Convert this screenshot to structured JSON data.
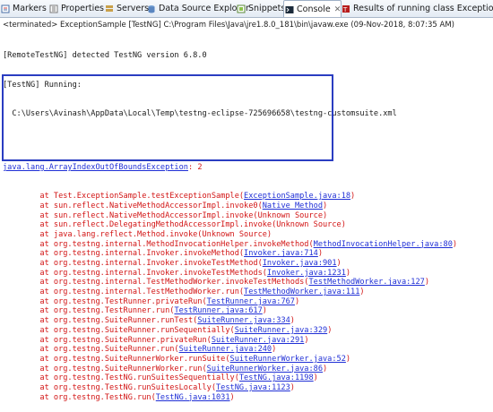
{
  "tabs": [
    {
      "label": "Markers",
      "icon": "markers-icon",
      "active": false
    },
    {
      "label": "Properties",
      "icon": "properties-icon",
      "active": false
    },
    {
      "label": "Servers",
      "icon": "servers-icon",
      "active": false
    },
    {
      "label": "Data Source Explorer",
      "icon": "database-icon",
      "active": false
    },
    {
      "label": "Snippets",
      "icon": "snippets-icon",
      "active": false
    },
    {
      "label": "Console",
      "icon": "console-icon",
      "active": true,
      "close": "✕"
    },
    {
      "label": "Results of running class ExceptionSample",
      "icon": "testng-icon",
      "active": false
    }
  ],
  "status_line": "<terminated> ExceptionSample [TestNG] C:\\Program Files\\Java\\jre1.8.0_181\\bin\\javaw.exe (09-Nov-2018, 8:07:35 AM)",
  "header_lines": [
    "[RemoteTestNG] detected TestNG version 6.8.0",
    "[TestNG] Running:",
    "  C:\\Users\\Avinash\\AppData\\Local\\Temp\\testng-eclipse-725696658\\testng-customsuite.xml"
  ],
  "exception": {
    "name": "java.lang.ArrayIndexOutOfBoundsException",
    "message": ": 2"
  },
  "stack": [
    {
      "pre": "        at Test.ExceptionSample.testExceptionSample(",
      "link": "ExceptionSample.java:18",
      "post": ")"
    },
    {
      "pre": "        at sun.reflect.NativeMethodAccessorImpl.invoke0(",
      "link": "Native Method",
      "post": ")"
    },
    {
      "pre": "        at sun.reflect.NativeMethodAccessorImpl.invoke(Unknown Source)",
      "link": "",
      "post": ""
    },
    {
      "pre": "        at sun.reflect.DelegatingMethodAccessorImpl.invoke(Unknown Source)",
      "link": "",
      "post": ""
    },
    {
      "pre": "        at java.lang.reflect.Method.invoke(Unknown Source)",
      "link": "",
      "post": ""
    },
    {
      "pre": "        at org.testng.internal.MethodInvocationHelper.invokeMethod(",
      "link": "MethodInvocationHelper.java:80",
      "post": ")"
    },
    {
      "pre": "        at org.testng.internal.Invoker.invokeMethod(",
      "link": "Invoker.java:714",
      "post": ")"
    },
    {
      "pre": "        at org.testng.internal.Invoker.invokeTestMethod(",
      "link": "Invoker.java:901",
      "post": ")"
    },
    {
      "pre": "        at org.testng.internal.Invoker.invokeTestMethods(",
      "link": "Invoker.java:1231",
      "post": ")"
    },
    {
      "pre": "        at org.testng.internal.TestMethodWorker.invokeTestMethods(",
      "link": "TestMethodWorker.java:127",
      "post": ")"
    },
    {
      "pre": "        at org.testng.internal.TestMethodWorker.run(",
      "link": "TestMethodWorker.java:111",
      "post": ")"
    },
    {
      "pre": "        at org.testng.TestRunner.privateRun(",
      "link": "TestRunner.java:767",
      "post": ")"
    },
    {
      "pre": "        at org.testng.TestRunner.run(",
      "link": "TestRunner.java:617",
      "post": ")"
    },
    {
      "pre": "        at org.testng.SuiteRunner.runTest(",
      "link": "SuiteRunner.java:334",
      "post": ")"
    },
    {
      "pre": "        at org.testng.SuiteRunner.runSequentially(",
      "link": "SuiteRunner.java:329",
      "post": ")"
    },
    {
      "pre": "        at org.testng.SuiteRunner.privateRun(",
      "link": "SuiteRunner.java:291",
      "post": ")"
    },
    {
      "pre": "        at org.testng.SuiteRunner.run(",
      "link": "SuiteRunner.java:240",
      "post": ")"
    },
    {
      "pre": "        at org.testng.SuiteRunnerWorker.runSuite(",
      "link": "SuiteRunnerWorker.java:52",
      "post": ")"
    },
    {
      "pre": "        at org.testng.SuiteRunnerWorker.run(",
      "link": "SuiteRunnerWorker.java:86",
      "post": ")"
    },
    {
      "pre": "        at org.testng.TestNG.runSuitesSequentially(",
      "link": "TestNG.java:1198",
      "post": ")"
    },
    {
      "pre": "        at org.testng.TestNG.runSuitesLocally(",
      "link": "TestNG.java:1123",
      "post": ")"
    },
    {
      "pre": "        at org.testng.TestNG.run(",
      "link": "TestNG.java:1031",
      "post": ")"
    }
  ]
}
